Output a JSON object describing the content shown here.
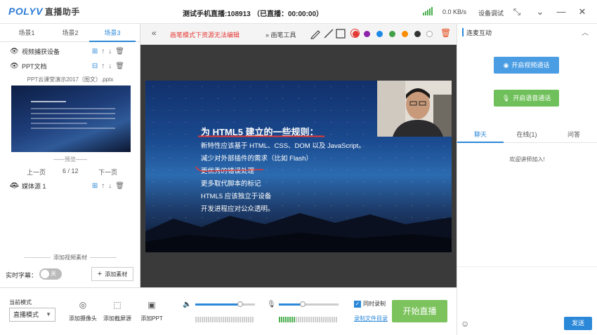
{
  "app": {
    "logo": "POLYV",
    "name": "直播助手",
    "live_title": "测试手机直播:108913",
    "live_timer": "（已直播：00:00:00）",
    "net_speed": "0.0 KB/s",
    "device_test": "设备调试"
  },
  "scenes": {
    "tabs": [
      "场景1",
      "场景2",
      "场景3"
    ],
    "active": "场景3"
  },
  "sources": [
    {
      "name": "视频捕获设备",
      "visible": true
    },
    {
      "name": "PPT文档",
      "visible": true
    },
    {
      "name": "媒体源 1",
      "visible": false
    }
  ],
  "ppt": {
    "filename": "PPT云课堂演示2017（图文）.pptx",
    "preview_label": "预览",
    "prev": "上一页",
    "page": "6 / 12",
    "next": "下一页"
  },
  "left_bottom": {
    "add_video_source": "添加视频素材",
    "subtitle_label": "实时字幕：",
    "subtitle_toggle": "关",
    "add_material": "添加素材"
  },
  "stage_toolbar": {
    "warning": "画笔模式下资源无法编辑",
    "pen_tools": "画笔工具",
    "colors": [
      "#e53935",
      "#8e24aa",
      "#1e88e5",
      "#43a047",
      "#fb8c00",
      "#333333",
      "#ffffff"
    ]
  },
  "slide": {
    "title": "为 HTML5 建立的一些规则：",
    "lines": [
      "新特性应该基于 HTML、CSS、DOM 以及 JavaScript。",
      "减少对外部插件的需求（比如 Flash）",
      "更优秀的错误处理",
      "更多取代脚本的标记",
      "HTML5 应该独立于设备",
      "开发进程应对公众透明。"
    ]
  },
  "interaction": {
    "header": "连麦互动",
    "video_call": "开启视频通话",
    "voice_call": "开启语音通话"
  },
  "chat": {
    "tabs": [
      "聊天",
      "在线(1)",
      "问答"
    ],
    "active": "聊天",
    "welcome": "欢迎讲师加入!",
    "send": "发送"
  },
  "bottom": {
    "mode_label": "当前模式",
    "mode_value": "直播模式",
    "add_camera": "添加摄像头",
    "add_screen": "添加截屏源",
    "add_ppt": "添加PPT",
    "speaker_volume": 0.75,
    "mic_volume": 0.4,
    "sync_record": "同时录制",
    "record_dir": "录制文件目录",
    "start_live": "开始直播"
  }
}
